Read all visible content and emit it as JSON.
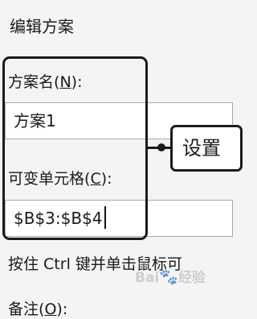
{
  "dialog": {
    "title": "编辑方案"
  },
  "scenario_name": {
    "label": "方案名",
    "mnemonic": "N",
    "suffix": ":",
    "value": "方案1"
  },
  "changing_cells": {
    "label": "可变单元格",
    "mnemonic": "C",
    "suffix": ":",
    "value": "$B$3:$B$4"
  },
  "callout": {
    "text": "设置"
  },
  "hint": {
    "text": "按住 Ctrl 键并单击鼠标可"
  },
  "comment": {
    "label": "备注",
    "mnemonic": "O",
    "suffix": ":"
  },
  "watermark": {
    "text_before": "Bai",
    "text_after": "经验",
    "icon": "baidu-paw-icon"
  }
}
